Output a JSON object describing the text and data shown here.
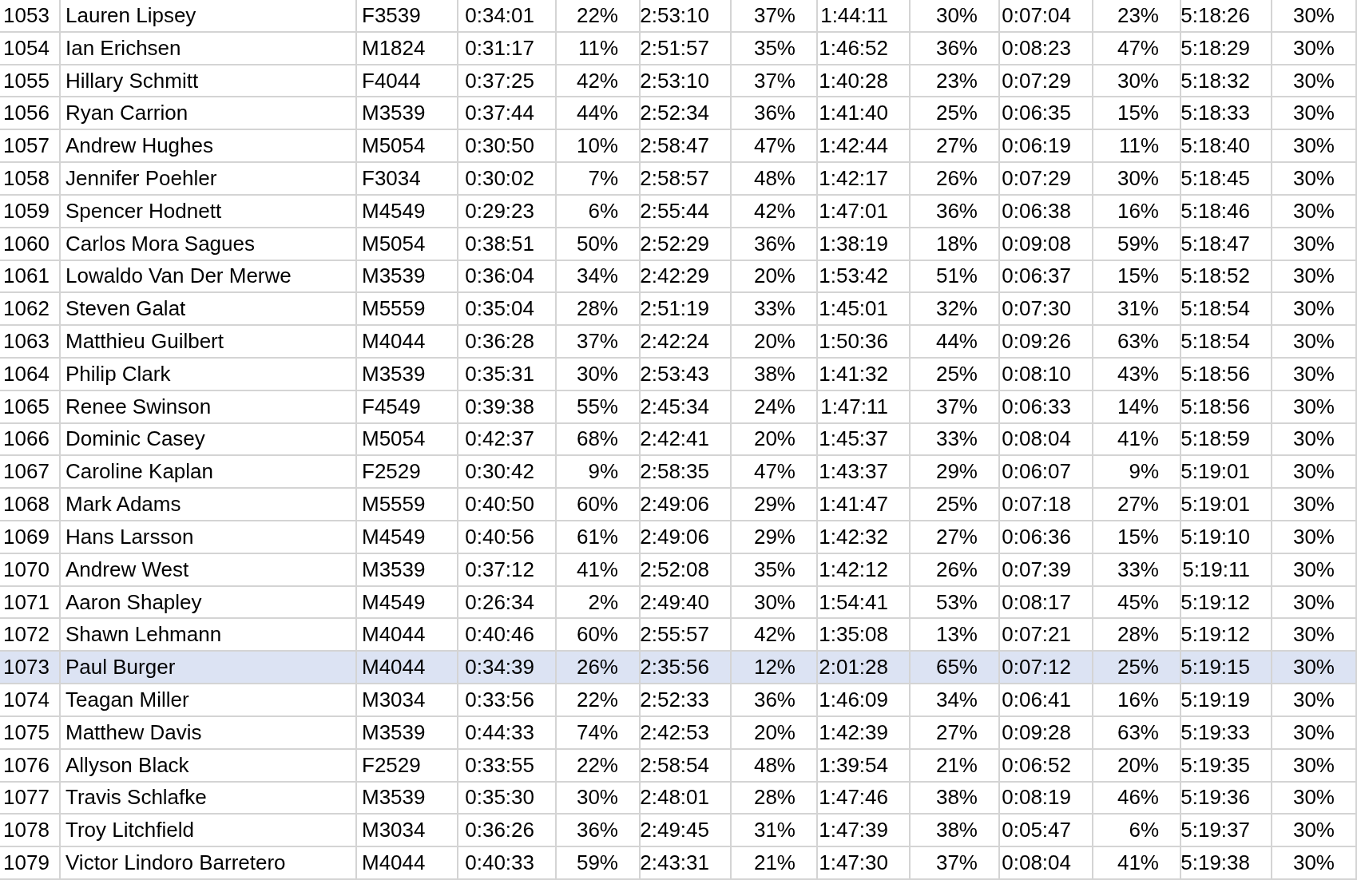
{
  "table": {
    "rows": [
      {
        "selected": false,
        "cells": [
          "1053",
          "Lauren Lipsey",
          "F3539",
          "0:34:01",
          "22%",
          "2:53:10",
          "37%",
          "1:44:11",
          "30%",
          "0:07:04",
          "23%",
          "5:18:26",
          "30%"
        ]
      },
      {
        "selected": false,
        "cells": [
          "1054",
          "Ian Erichsen",
          "M1824",
          "0:31:17",
          "11%",
          "2:51:57",
          "35%",
          "1:46:52",
          "36%",
          "0:08:23",
          "47%",
          "5:18:29",
          "30%"
        ]
      },
      {
        "selected": false,
        "cells": [
          "1055",
          "Hillary Schmitt",
          "F4044",
          "0:37:25",
          "42%",
          "2:53:10",
          "37%",
          "1:40:28",
          "23%",
          "0:07:29",
          "30%",
          "5:18:32",
          "30%"
        ]
      },
      {
        "selected": false,
        "cells": [
          "1056",
          "Ryan Carrion",
          "M3539",
          "0:37:44",
          "44%",
          "2:52:34",
          "36%",
          "1:41:40",
          "25%",
          "0:06:35",
          "15%",
          "5:18:33",
          "30%"
        ]
      },
      {
        "selected": false,
        "cells": [
          "1057",
          "Andrew Hughes",
          "M5054",
          "0:30:50",
          "10%",
          "2:58:47",
          "47%",
          "1:42:44",
          "27%",
          "0:06:19",
          "11%",
          "5:18:40",
          "30%"
        ]
      },
      {
        "selected": false,
        "cells": [
          "1058",
          "Jennifer Poehler",
          "F3034",
          "0:30:02",
          "7%",
          "2:58:57",
          "48%",
          "1:42:17",
          "26%",
          "0:07:29",
          "30%",
          "5:18:45",
          "30%"
        ]
      },
      {
        "selected": false,
        "cells": [
          "1059",
          "Spencer Hodnett",
          "M4549",
          "0:29:23",
          "6%",
          "2:55:44",
          "42%",
          "1:47:01",
          "36%",
          "0:06:38",
          "16%",
          "5:18:46",
          "30%"
        ]
      },
      {
        "selected": false,
        "cells": [
          "1060",
          "Carlos Mora Sagues",
          "M5054",
          "0:38:51",
          "50%",
          "2:52:29",
          "36%",
          "1:38:19",
          "18%",
          "0:09:08",
          "59%",
          "5:18:47",
          "30%"
        ]
      },
      {
        "selected": false,
        "cells": [
          "1061",
          "Lowaldo Van Der Merwe",
          "M3539",
          "0:36:04",
          "34%",
          "2:42:29",
          "20%",
          "1:53:42",
          "51%",
          "0:06:37",
          "15%",
          "5:18:52",
          "30%"
        ]
      },
      {
        "selected": false,
        "cells": [
          "1062",
          "Steven Galat",
          "M5559",
          "0:35:04",
          "28%",
          "2:51:19",
          "33%",
          "1:45:01",
          "32%",
          "0:07:30",
          "31%",
          "5:18:54",
          "30%"
        ]
      },
      {
        "selected": false,
        "cells": [
          "1063",
          "Matthieu Guilbert",
          "M4044",
          "0:36:28",
          "37%",
          "2:42:24",
          "20%",
          "1:50:36",
          "44%",
          "0:09:26",
          "63%",
          "5:18:54",
          "30%"
        ]
      },
      {
        "selected": false,
        "cells": [
          "1064",
          "Philip Clark",
          "M3539",
          "0:35:31",
          "30%",
          "2:53:43",
          "38%",
          "1:41:32",
          "25%",
          "0:08:10",
          "43%",
          "5:18:56",
          "30%"
        ]
      },
      {
        "selected": false,
        "cells": [
          "1065",
          "Renee Swinson",
          "F4549",
          "0:39:38",
          "55%",
          "2:45:34",
          "24%",
          "1:47:11",
          "37%",
          "0:06:33",
          "14%",
          "5:18:56",
          "30%"
        ]
      },
      {
        "selected": false,
        "cells": [
          "1066",
          "Dominic Casey",
          "M5054",
          "0:42:37",
          "68%",
          "2:42:41",
          "20%",
          "1:45:37",
          "33%",
          "0:08:04",
          "41%",
          "5:18:59",
          "30%"
        ]
      },
      {
        "selected": false,
        "cells": [
          "1067",
          "Caroline Kaplan",
          "F2529",
          "0:30:42",
          "9%",
          "2:58:35",
          "47%",
          "1:43:37",
          "29%",
          "0:06:07",
          "9%",
          "5:19:01",
          "30%"
        ]
      },
      {
        "selected": false,
        "cells": [
          "1068",
          "Mark Adams",
          "M5559",
          "0:40:50",
          "60%",
          "2:49:06",
          "29%",
          "1:41:47",
          "25%",
          "0:07:18",
          "27%",
          "5:19:01",
          "30%"
        ]
      },
      {
        "selected": false,
        "cells": [
          "1069",
          "Hans Larsson",
          "M4549",
          "0:40:56",
          "61%",
          "2:49:06",
          "29%",
          "1:42:32",
          "27%",
          "0:06:36",
          "15%",
          "5:19:10",
          "30%"
        ]
      },
      {
        "selected": false,
        "cells": [
          "1070",
          "Andrew West",
          "M3539",
          "0:37:12",
          "41%",
          "2:52:08",
          "35%",
          "1:42:12",
          "26%",
          "0:07:39",
          "33%",
          "5:19:11",
          "30%"
        ]
      },
      {
        "selected": false,
        "cells": [
          "1071",
          "Aaron Shapley",
          "M4549",
          "0:26:34",
          "2%",
          "2:49:40",
          "30%",
          "1:54:41",
          "53%",
          "0:08:17",
          "45%",
          "5:19:12",
          "30%"
        ]
      },
      {
        "selected": false,
        "cells": [
          "1072",
          "Shawn Lehmann",
          "M4044",
          "0:40:46",
          "60%",
          "2:55:57",
          "42%",
          "1:35:08",
          "13%",
          "0:07:21",
          "28%",
          "5:19:12",
          "30%"
        ]
      },
      {
        "selected": true,
        "cells": [
          "1073",
          "Paul Burger",
          "M4044",
          "0:34:39",
          "26%",
          "2:35:56",
          "12%",
          "2:01:28",
          "65%",
          "0:07:12",
          "25%",
          "5:19:15",
          "30%"
        ]
      },
      {
        "selected": false,
        "cells": [
          "1074",
          "Teagan Miller",
          "M3034",
          "0:33:56",
          "22%",
          "2:52:33",
          "36%",
          "1:46:09",
          "34%",
          "0:06:41",
          "16%",
          "5:19:19",
          "30%"
        ]
      },
      {
        "selected": false,
        "cells": [
          "1075",
          "Matthew Davis",
          "M3539",
          "0:44:33",
          "74%",
          "2:42:53",
          "20%",
          "1:42:39",
          "27%",
          "0:09:28",
          "63%",
          "5:19:33",
          "30%"
        ]
      },
      {
        "selected": false,
        "cells": [
          "1076",
          "Allyson Black",
          "F2529",
          "0:33:55",
          "22%",
          "2:58:54",
          "48%",
          "1:39:54",
          "21%",
          "0:06:52",
          "20%",
          "5:19:35",
          "30%"
        ]
      },
      {
        "selected": false,
        "cells": [
          "1077",
          "Travis Schlafke",
          "M3539",
          "0:35:30",
          "30%",
          "2:48:01",
          "28%",
          "1:47:46",
          "38%",
          "0:08:19",
          "46%",
          "5:19:36",
          "30%"
        ]
      },
      {
        "selected": false,
        "cells": [
          "1078",
          "Troy Litchfield",
          "M3034",
          "0:36:26",
          "36%",
          "2:49:45",
          "31%",
          "1:47:39",
          "38%",
          "0:05:47",
          "6%",
          "5:19:37",
          "30%"
        ]
      },
      {
        "selected": false,
        "cells": [
          "1079",
          "Victor Lindoro Barretero",
          "M4044",
          "0:40:33",
          "59%",
          "2:43:31",
          "21%",
          "1:47:30",
          "37%",
          "0:08:04",
          "41%",
          "5:19:38",
          "30%"
        ]
      }
    ]
  }
}
